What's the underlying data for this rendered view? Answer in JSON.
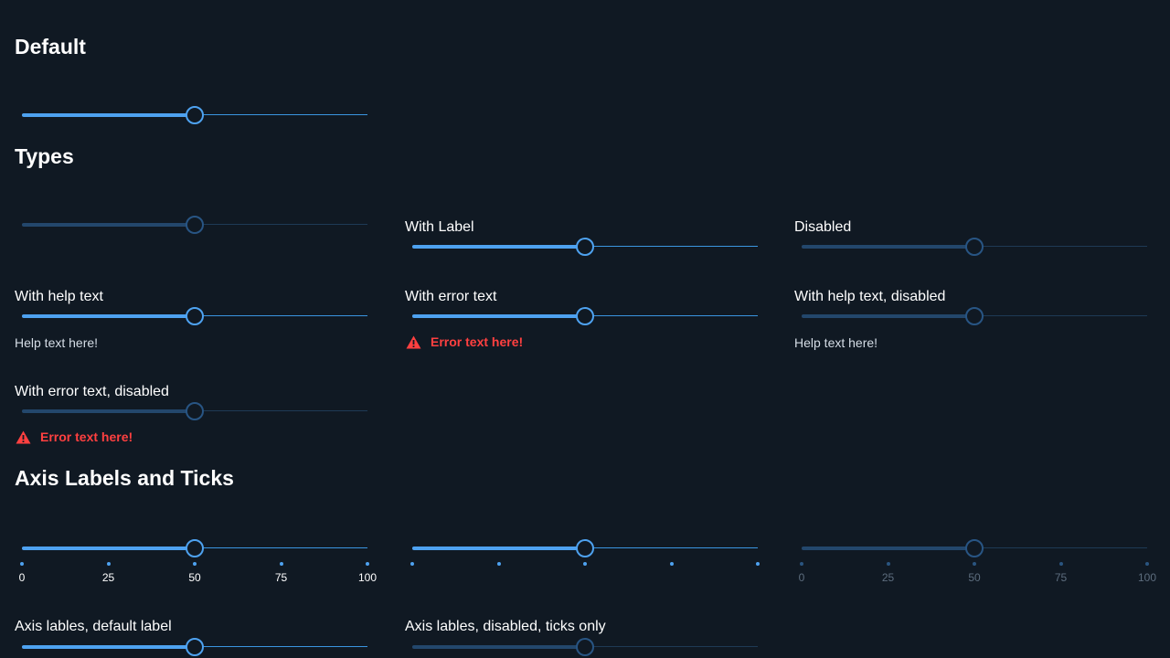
{
  "sections": {
    "default_title": "Default",
    "types_title": "Types",
    "axis_title": "Axis Labels and Ticks"
  },
  "sliders": {
    "default": {
      "value": 50,
      "disabled": false
    },
    "types_plain": {
      "value": 50,
      "disabled": true
    },
    "with_label": {
      "label": "With Label",
      "value": 50,
      "disabled": false
    },
    "disabled": {
      "label": "Disabled",
      "value": 50,
      "disabled": true
    },
    "with_help": {
      "label": "With help text",
      "help": "Help text here!",
      "value": 50,
      "disabled": false
    },
    "with_error": {
      "label": "With error text",
      "error": "Error text here!",
      "value": 50,
      "disabled": false
    },
    "with_help_disabled": {
      "label": "With help text, disabled",
      "help": "Help text here!",
      "value": 50,
      "disabled": true
    },
    "with_error_disabled": {
      "label": "With error text, disabled",
      "error": "Error text here!",
      "value": 50,
      "disabled": true
    },
    "axis_labels": {
      "value": 50,
      "disabled": false,
      "ticks": [
        "0",
        "25",
        "50",
        "75",
        "100"
      ]
    },
    "axis_ticks_only": {
      "value": 50,
      "disabled": false
    },
    "axis_disabled": {
      "value": 50,
      "disabled": true,
      "ticks": [
        "0",
        "25",
        "50",
        "75",
        "100"
      ]
    },
    "axis_default_label": {
      "label": "Axis lables, default label",
      "value": 50,
      "disabled": false
    },
    "axis_disabled_ticks_only": {
      "label": "Axis lables, disabled, ticks only",
      "value": 50,
      "disabled": true
    }
  },
  "colors": {
    "background": "#101923",
    "accent": "#4ea2f0",
    "disabled": "#285584",
    "error": "#ff4040"
  },
  "icons": {
    "error": "warning-triangle-icon"
  }
}
